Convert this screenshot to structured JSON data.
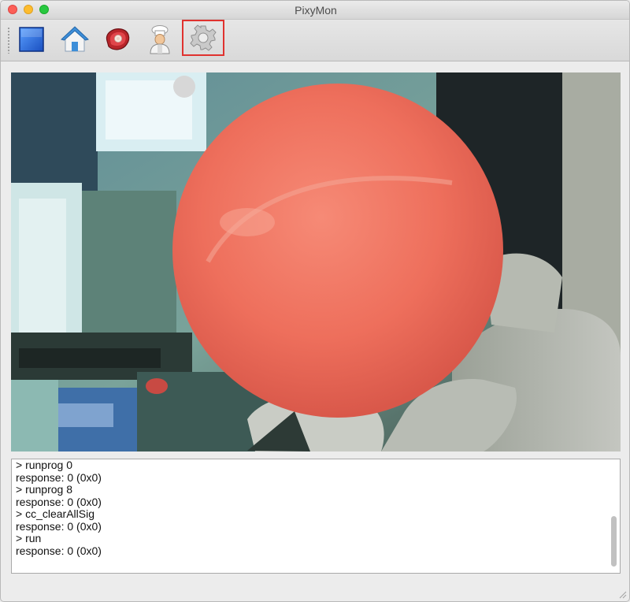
{
  "window": {
    "title": "PixyMon"
  },
  "toolbar": {
    "buttons": [
      {
        "name": "stop-button",
        "icon": "stop-square-icon"
      },
      {
        "name": "home-button",
        "icon": "home-icon"
      },
      {
        "name": "raw-video-button",
        "icon": "meat-steak-icon"
      },
      {
        "name": "cooked-video-button",
        "icon": "chef-icon"
      },
      {
        "name": "configure-button",
        "icon": "gear-icon",
        "highlighted": true
      }
    ]
  },
  "console": {
    "lines": [
      "> runprog 0",
      "response: 0 (0x0)",
      "> runprog 8",
      "response: 0 (0x0)",
      "> cc_clearAllSig",
      "response: 0 (0x0)",
      "> run",
      "response: 0 (0x0)"
    ]
  },
  "colors": {
    "highlight_border": "#e0322f",
    "accent_blue": "#2a6fd6"
  }
}
